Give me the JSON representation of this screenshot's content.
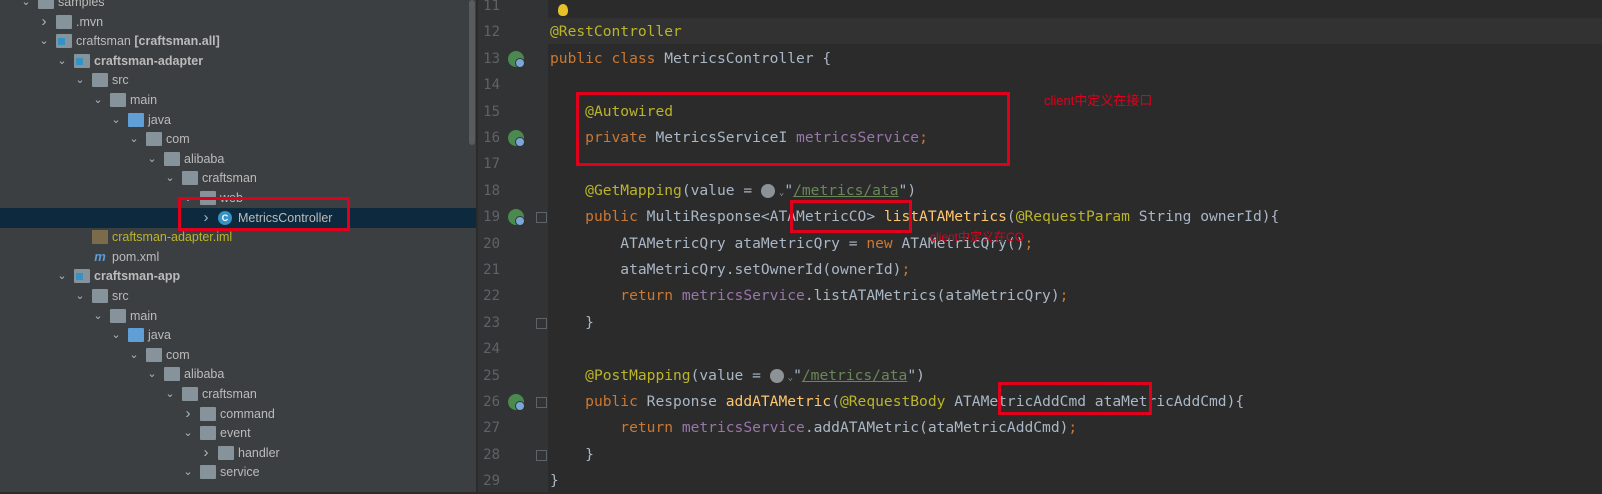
{
  "tree": {
    "rows": [
      {
        "label": "samples",
        "indent": 2,
        "chev": "v",
        "icon": "folder"
      },
      {
        "label": ".mvn",
        "indent": 3,
        "chev": ">",
        "icon": "folder"
      },
      {
        "label": "craftsman",
        "suffix": "[craftsman.all]",
        "indent": 3,
        "chev": "v",
        "icon": "module"
      },
      {
        "label": "craftsman-adapter",
        "indent": 4,
        "chev": "v",
        "icon": "module",
        "bold": true
      },
      {
        "label": "src",
        "indent": 5,
        "chev": "v",
        "icon": "folder"
      },
      {
        "label": "main",
        "indent": 6,
        "chev": "v",
        "icon": "folder"
      },
      {
        "label": "java",
        "indent": 7,
        "chev": "v",
        "icon": "folder-blue"
      },
      {
        "label": "com",
        "indent": 8,
        "chev": "v",
        "icon": "package"
      },
      {
        "label": "alibaba",
        "indent": 9,
        "chev": "v",
        "icon": "package"
      },
      {
        "label": "craftsman",
        "indent": 10,
        "chev": "v",
        "icon": "package"
      },
      {
        "label": "web",
        "indent": 11,
        "chev": "v",
        "icon": "package"
      },
      {
        "label": "MetricsController",
        "indent": 12,
        "chev": ">",
        "icon": "class",
        "selected": true
      },
      {
        "label": "craftsman-adapter.iml",
        "indent": 5,
        "chev": "",
        "icon": "iml",
        "yellow": true
      },
      {
        "label": "pom.xml",
        "indent": 5,
        "chev": "",
        "icon": "pom"
      },
      {
        "label": "craftsman-app",
        "indent": 4,
        "chev": "v",
        "icon": "module",
        "bold": true
      },
      {
        "label": "src",
        "indent": 5,
        "chev": "v",
        "icon": "folder"
      },
      {
        "label": "main",
        "indent": 6,
        "chev": "v",
        "icon": "folder"
      },
      {
        "label": "java",
        "indent": 7,
        "chev": "v",
        "icon": "folder-blue"
      },
      {
        "label": "com",
        "indent": 8,
        "chev": "v",
        "icon": "package"
      },
      {
        "label": "alibaba",
        "indent": 9,
        "chev": "v",
        "icon": "package"
      },
      {
        "label": "craftsman",
        "indent": 10,
        "chev": "v",
        "icon": "package"
      },
      {
        "label": "command",
        "indent": 11,
        "chev": ">",
        "icon": "package"
      },
      {
        "label": "event",
        "indent": 11,
        "chev": "v",
        "icon": "package"
      },
      {
        "label": "handler",
        "indent": 12,
        "chev": ">",
        "icon": "package"
      },
      {
        "label": "service",
        "indent": 11,
        "chev": "v",
        "icon": "package"
      }
    ]
  },
  "editor": {
    "line_numbers": [
      "11",
      "12",
      "13",
      "14",
      "15",
      "16",
      "17",
      "18",
      "19",
      "20",
      "21",
      "22",
      "23",
      "24",
      "25",
      "26",
      "27",
      "28",
      "29"
    ],
    "lines": [
      [],
      [
        [
          "ann",
          "@RestController"
        ]
      ],
      [
        [
          "kw",
          "public class "
        ],
        [
          "",
          "MetricsController {"
        ]
      ],
      [],
      [
        [
          "",
          "    "
        ],
        [
          "ann",
          "@Autowired"
        ]
      ],
      [
        [
          "",
          "    "
        ],
        [
          "kw",
          "private "
        ],
        [
          "",
          "MetricsServiceI "
        ],
        [
          "fld",
          "metricsService"
        ],
        [
          "kw",
          ";"
        ]
      ],
      [],
      [
        [
          "",
          "    "
        ],
        [
          "ann",
          "@GetMapping"
        ],
        [
          "",
          "(value = "
        ],
        [
          "globe",
          ""
        ],
        [
          "",
          "\""
        ],
        [
          "str",
          "/metrics/ata"
        ],
        [
          "",
          "\")"
        ]
      ],
      [
        [
          "",
          "    "
        ],
        [
          "kw",
          "public "
        ],
        [
          "",
          "MultiResponse<ATAMetricCO> "
        ],
        [
          "fn",
          "listATAMetrics"
        ],
        [
          "",
          "("
        ],
        [
          "ann",
          "@RequestParam "
        ],
        [
          "",
          "String ownerId){"
        ]
      ],
      [
        [
          "",
          "        ATAMetricQry ataMetricQry = "
        ],
        [
          "kw",
          "new "
        ],
        [
          "",
          "ATAMetricQry()"
        ],
        [
          "kw",
          ";"
        ]
      ],
      [
        [
          "",
          "        ataMetricQry.setOwnerId(ownerId)"
        ],
        [
          "kw",
          ";"
        ]
      ],
      [
        [
          "",
          "        "
        ],
        [
          "kw",
          "return "
        ],
        [
          "fld",
          "metricsService"
        ],
        [
          "",
          ".listATAMetrics(ataMetricQry)"
        ],
        [
          "kw",
          ";"
        ]
      ],
      [
        [
          "",
          "    }"
        ]
      ],
      [],
      [
        [
          "",
          "    "
        ],
        [
          "ann",
          "@PostMapping"
        ],
        [
          "",
          "(value = "
        ],
        [
          "globe",
          ""
        ],
        [
          "",
          "\""
        ],
        [
          "str",
          "/metrics/ata"
        ],
        [
          "",
          "\")"
        ]
      ],
      [
        [
          "",
          "    "
        ],
        [
          "kw",
          "public "
        ],
        [
          "",
          "Response "
        ],
        [
          "fn",
          "addATAMetric"
        ],
        [
          "",
          "("
        ],
        [
          "ann",
          "@RequestBody "
        ],
        [
          "",
          "ATAMetricAddCmd ataMetricAddCmd){"
        ]
      ],
      [
        [
          "",
          "        "
        ],
        [
          "kw",
          "return "
        ],
        [
          "fld",
          "metricsService"
        ],
        [
          "",
          ".addATAMetric(ataMetricAddCmd)"
        ],
        [
          "kw",
          ";"
        ]
      ],
      [
        [
          "",
          "    }"
        ]
      ],
      [
        [
          "",
          "}"
        ]
      ]
    ],
    "notes": {
      "client_interface": "client中定义在接口",
      "client_co": "client中定义在CO"
    }
  }
}
